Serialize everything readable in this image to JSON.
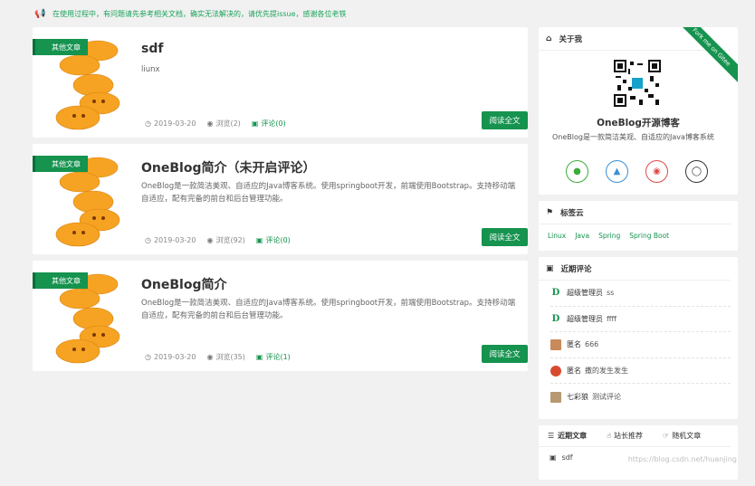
{
  "notice": {
    "text": "在使用过程中，有问题请先参考相关文档，确实无法解决的，请优先提issue，感谢各位老铁",
    "icon": "bullhorn-icon"
  },
  "posts": [
    {
      "tag": "其他文章",
      "title": "sdf",
      "desc": "liunx",
      "date": "2019-03-20",
      "views": "浏览(2)",
      "comments": "评论(0)",
      "read": "阅读全文"
    },
    {
      "tag": "其他文章",
      "title": "OneBlog简介（未开启评论）",
      "desc": "OneBlog是一款简洁美观、自适应的Java博客系统。使用springboot开发，前端使用Bootstrap。支持移动端自适应，配有完备的前台和后台管理功能。",
      "date": "2019-03-20",
      "views": "浏览(92)",
      "comments": "评论(0)",
      "read": "阅读全文"
    },
    {
      "tag": "其他文章",
      "title": "OneBlog简介",
      "desc": "OneBlog是一款简洁美观、自适应的Java博客系统。使用springboot开发，前端使用Bootstrap。支持移动端自适应，配有完备的前台和后台管理功能。",
      "date": "2019-03-20",
      "views": "浏览(35)",
      "comments": "评论(1)",
      "read": "阅读全文"
    }
  ],
  "about": {
    "header": "关于我",
    "ribbon": "Fork me on Gitee",
    "name": "OneBlog开源博客",
    "intro": "OneBlog是一款简洁美观、自适应的Java博客系统"
  },
  "tagcloud": {
    "header": "标签云",
    "tags": [
      "Linux",
      "Java",
      "Spring",
      "Spring Boot"
    ]
  },
  "comments": {
    "header": "近期评论",
    "items": [
      {
        "name": "超级管理员",
        "text": "ss",
        "avatar": "D"
      },
      {
        "name": "超级管理员",
        "text": "ffff",
        "avatar": "D"
      },
      {
        "name": "匿名",
        "text": "666",
        "avatar": ""
      },
      {
        "name": "匿名",
        "text": "撒的发生发生",
        "avatar": ""
      },
      {
        "name": "七彩狼",
        "text": "测试评论",
        "avatar": ""
      }
    ]
  },
  "recent": {
    "tabs": [
      "近期文章",
      "站长推荐",
      "随机文章"
    ],
    "first": "sdf"
  },
  "watermark": "https://blog.csdn.net/huanjing"
}
